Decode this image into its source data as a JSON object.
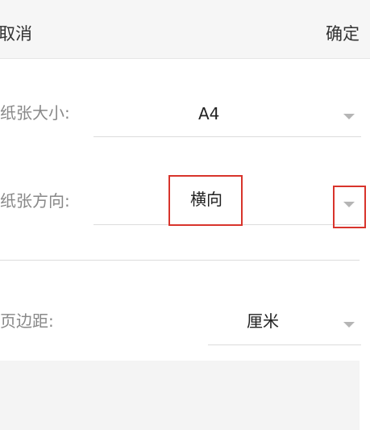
{
  "header": {
    "cancel_label": "取消",
    "confirm_label": "确定"
  },
  "paper_size": {
    "label": "纸张大小:",
    "value": "A4"
  },
  "paper_orientation": {
    "label": "纸张方向:",
    "value": "横向"
  },
  "page_margin": {
    "label": "页边距:",
    "unit_value": "厘米"
  },
  "icons": {
    "dropdown": "chevron-down-icon"
  },
  "colors": {
    "highlight": "#d8342c",
    "header_bg": "#f6f6f6"
  }
}
